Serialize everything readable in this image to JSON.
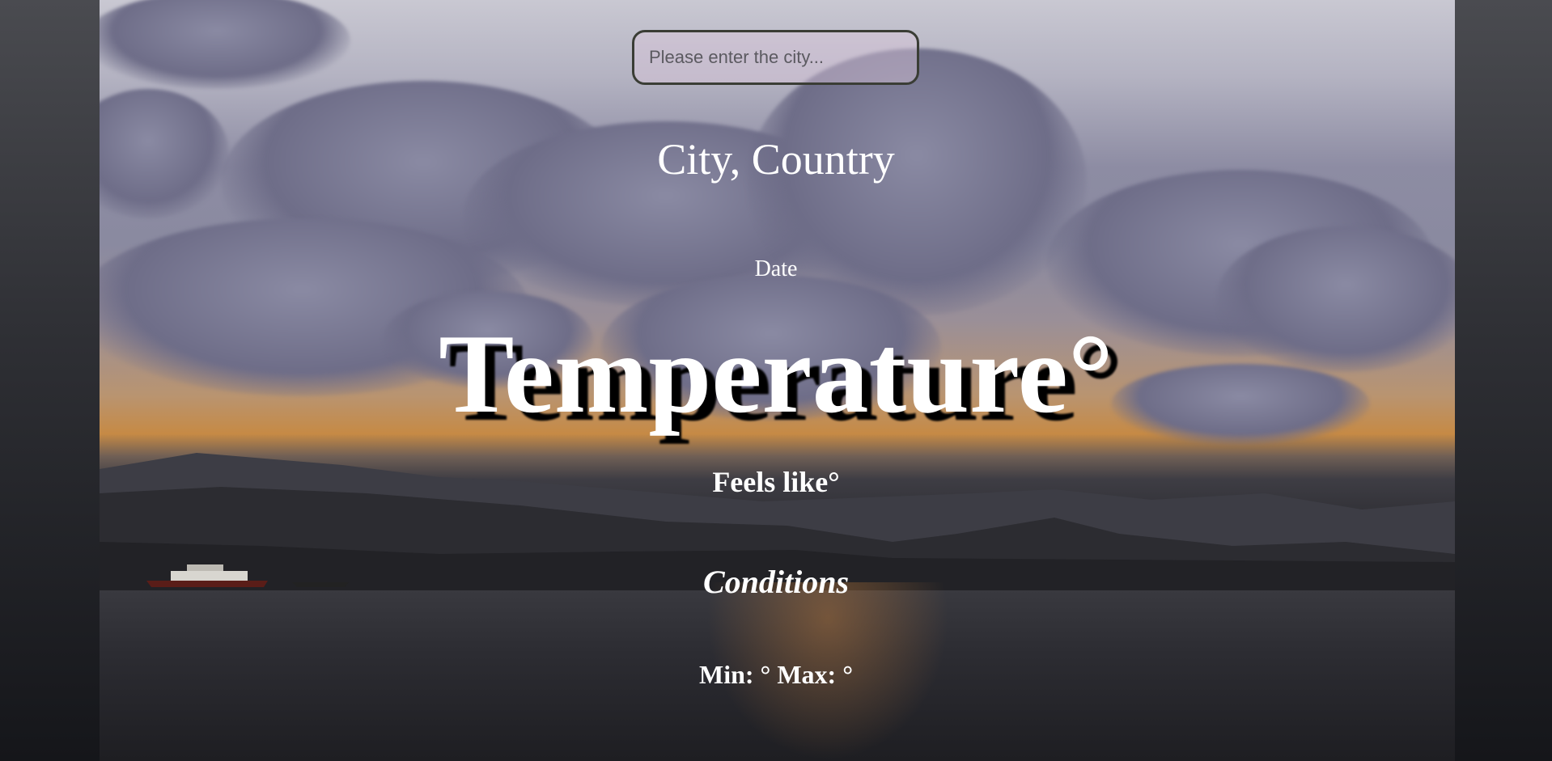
{
  "search": {
    "placeholder": "Please enter the city...",
    "value": ""
  },
  "weather": {
    "location": "City, Country",
    "date": "Date",
    "temperature": "Temperature°",
    "feels_like": "Feels like°",
    "conditions": "Conditions",
    "min_max": "Min: ° Max: °"
  },
  "background": {
    "image": "sunset-clouds-over-bay",
    "page_color": "#2e2f34",
    "text_color": "#ffffff"
  }
}
